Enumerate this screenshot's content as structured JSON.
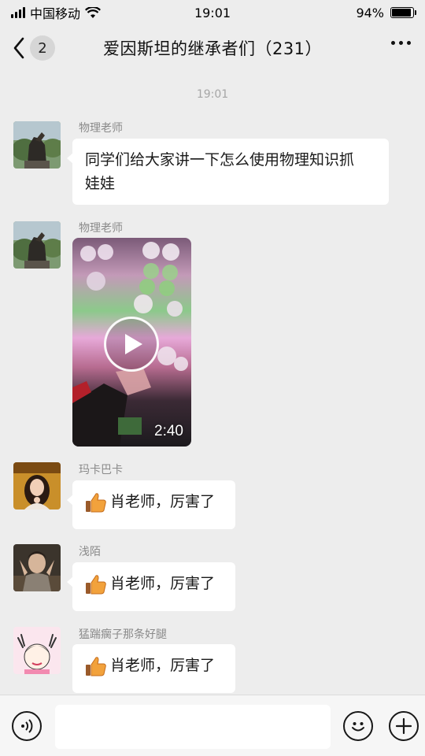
{
  "status_bar": {
    "carrier": "中国移动",
    "time": "19:01",
    "battery_percent": "94%",
    "battery_level": 0.94,
    "signal_icon": "signal-icon",
    "wifi_icon": "wifi-icon"
  },
  "nav": {
    "unread_count": "2",
    "title": "爱因斯坦的继承者们（231）",
    "back_icon": "chevron-left-icon",
    "more_icon": "more-icon"
  },
  "chat": {
    "time_label": "19:01",
    "messages": [
      {
        "sender": "物理老师",
        "text": "同学们给大家讲一下怎么使用物理知识抓娃娃",
        "text_line1": "同学们给大家讲一下怎么使用物理知识抓",
        "text_line2": "娃娃"
      },
      {
        "sender": "物理老师",
        "video": {
          "duration": "2:40"
        }
      },
      {
        "sender": "玛卡巴卡",
        "text": "肖老师，厉害了",
        "emoji": "thumbs-up-icon"
      },
      {
        "sender": "浅陌",
        "text": "肖老师，厉害了",
        "emoji": "thumbs-up-icon"
      },
      {
        "sender": "猛踹瘸子那条好腿",
        "text": "肖老师，厉害了",
        "emoji": "thumbs-up-icon"
      }
    ]
  },
  "input_bar": {
    "voice_icon": "voice-icon",
    "emoji_icon": "emoji-icon",
    "add_icon": "plus-icon",
    "input_value": ""
  },
  "colors": {
    "background": "#ededed",
    "bubble": "#ffffff",
    "sender_text": "#8a8a8a"
  }
}
